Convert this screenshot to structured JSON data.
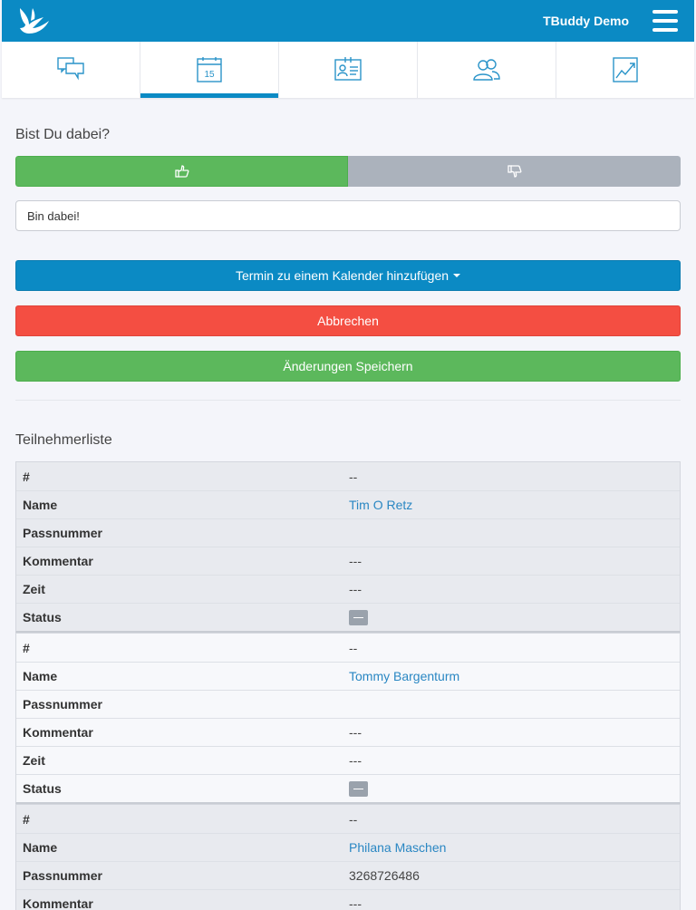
{
  "header": {
    "brand": "TBuddy Demo"
  },
  "nav": {
    "tabs": [
      {
        "icon": "chat-icon"
      },
      {
        "icon": "calendar-icon",
        "label": "15",
        "active": true
      },
      {
        "icon": "id-card-icon"
      },
      {
        "icon": "users-icon"
      },
      {
        "icon": "chart-icon"
      }
    ]
  },
  "attendance": {
    "question": "Bist Du dabei?",
    "comment_value": "Bin dabei!"
  },
  "actions": {
    "add_calendar": "Termin zu einem Kalender hinzufügen",
    "cancel": "Abbrechen",
    "save": "Änderungen Speichern"
  },
  "participants": {
    "title": "Teilnehmerliste",
    "labels": {
      "number": "#",
      "name": "Name",
      "passnumber": "Passnummer",
      "comment": "Kommentar",
      "time": "Zeit",
      "status": "Status"
    },
    "rows": [
      {
        "number": "--",
        "name": "Tim O Retz",
        "passnumber": "",
        "comment": "---",
        "time": "---"
      },
      {
        "number": "--",
        "name": "Tommy Bargenturm",
        "passnumber": "",
        "comment": "---",
        "time": "---"
      },
      {
        "number": "--",
        "name": "Philana Maschen",
        "passnumber": "3268726486",
        "comment": "---",
        "time": "---"
      }
    ]
  },
  "colors": {
    "primary": "#0b8ac4",
    "success": "#5cb85c",
    "danger": "#f44e42",
    "neutral": "#abb2bc"
  }
}
